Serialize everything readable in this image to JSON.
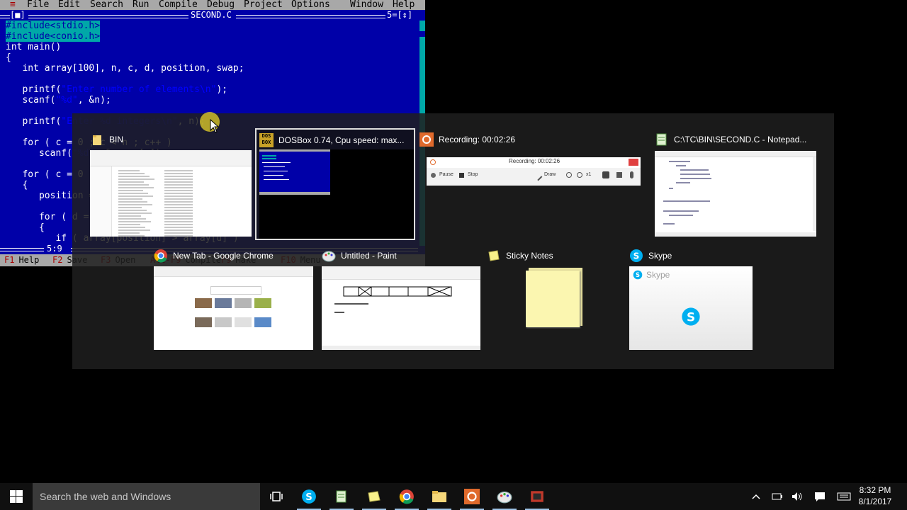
{
  "dos": {
    "menu": [
      "≡",
      "File",
      "Edit",
      "Search",
      "Run",
      "Compile",
      "Debug",
      "Project",
      "Options",
      "Window",
      "Help"
    ],
    "window_controls_left": "[■]",
    "file_title": "SECOND.C",
    "window_controls_right": "5=[↕]",
    "cursor_pos": "5:9",
    "code": [
      {
        "pp": "#include<stdio.h>"
      },
      {
        "pp": "#include<conio.h>"
      },
      {
        "t": "int main()"
      },
      {
        "t": "{"
      },
      {
        "t": "   int array[100], n, c, d, position, swap;"
      },
      {
        "t": ""
      },
      {
        "t": "   printf(",
        "s": "\"Enter number of elements\\n\"",
        "e": ");"
      },
      {
        "t": "   scanf(",
        "s": "\"%d\"",
        "e": ", &n);"
      },
      {
        "t": ""
      },
      {
        "t": "   printf(",
        "s": "\"Enter %d integers\\n\"",
        "e": ", n);"
      },
      {
        "t": ""
      },
      {
        "t": "   for ( c = 0 ; c < n ; c++ )"
      },
      {
        "t": "      scanf(",
        "s": "\"%d\"",
        "e": ", &array[c]);"
      },
      {
        "t": ""
      },
      {
        "t": "   for ( c = 0 ; c < ( n - 1 ) ; c++ )"
      },
      {
        "t": "   {"
      },
      {
        "t": "      position = c;"
      },
      {
        "t": ""
      },
      {
        "t": "      for ( d = c + 1 ; d < n ; d++ )"
      },
      {
        "t": "      {"
      },
      {
        "t": "         if ( array[position] > array[d] )"
      }
    ],
    "status": [
      {
        "key": "F1",
        "label": "Help"
      },
      {
        "key": "F2",
        "label": "Save"
      },
      {
        "key": "F3",
        "label": "Open"
      },
      {
        "key": "Alt-F9",
        "label": "Compile"
      },
      {
        "key": "F9",
        "label": "Make"
      },
      {
        "key": "F10",
        "label": "Menu"
      }
    ]
  },
  "taskview": {
    "windows": [
      {
        "title": "BIN",
        "icon": "folder-icon"
      },
      {
        "title": "DOSBox 0.74, Cpu speed: max...",
        "icon": "dosbox-icon",
        "icon_text": "DOS BOX"
      },
      {
        "title": "Recording:  00:02:26",
        "icon": "recorder-icon"
      },
      {
        "title": "C:\\TC\\BIN\\SECOND.C - Notepad...",
        "icon": "notepad-icon"
      },
      {
        "title": "New Tab - Google Chrome",
        "icon": "chrome-icon"
      },
      {
        "title": "Untitled - Paint",
        "icon": "paint-icon"
      },
      {
        "title": "Sticky Notes",
        "icon": "sticky-notes-icon"
      },
      {
        "title": "Skype",
        "icon": "skype-icon"
      }
    ],
    "recorder_thumb": {
      "title": "Recording:  00:02:26",
      "pause": "Pause",
      "stop": "Stop",
      "draw": "Draw",
      "zoom": "x1"
    },
    "skype_thumb_label": "Skype"
  },
  "taskbar": {
    "search_placeholder": "Search the web and Windows",
    "time": "8:32 PM",
    "date": "8/1/2017"
  },
  "colors": {
    "dos_blue": "#0000a8",
    "dos_gray": "#a8a8a8",
    "dos_red": "#a80000",
    "dos_cyan": "#00a8a8",
    "taskbar": "#101010",
    "search_box": "#3a3a3a"
  }
}
